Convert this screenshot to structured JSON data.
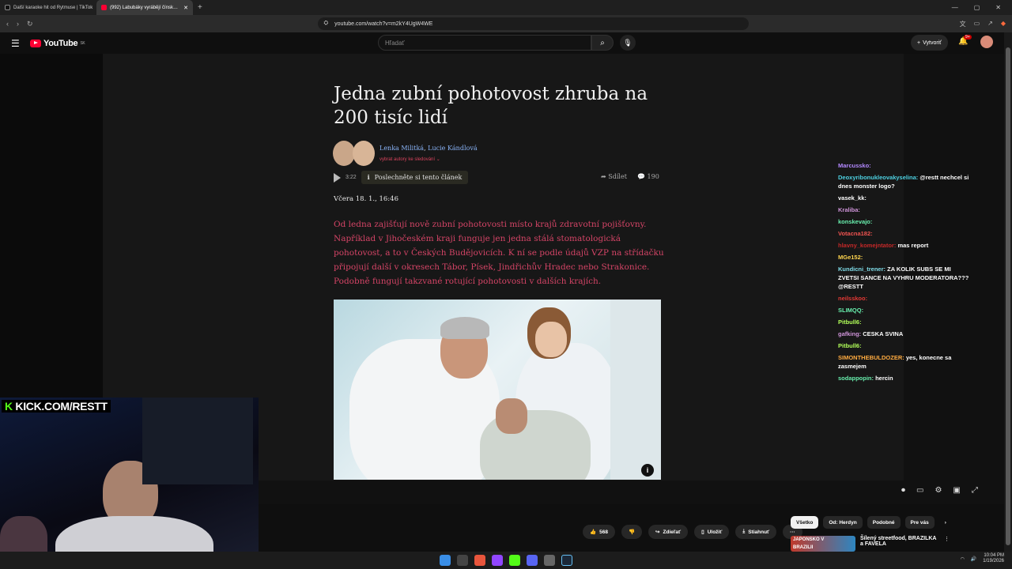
{
  "browser": {
    "tabs": [
      {
        "title": "Další karaoke hit od Rytmuse | TikTok",
        "active": false
      },
      {
        "title": "(992) Labubáky vyrábějí čínsk…",
        "active": true
      }
    ],
    "url": "youtube.com/watch?v=m2kY4UgW4WE"
  },
  "youtube": {
    "logo_text": "YouTube",
    "logo_region": "SK",
    "search_placeholder": "Hľadať",
    "create_label": "Vytvoriť",
    "notif_count": "9+"
  },
  "article": {
    "title": "Jedna zubní pohotovost zhruba na 200 tisíc lidí",
    "author1": "Lenka Militká",
    "author_sep": ",",
    "author2": "Lucie Kándlová",
    "follow_label": "vybrat autory ke sledování",
    "listen_time": "3:22",
    "listen_label": "Poslechněte si tento článek",
    "share_label": "Sdílet",
    "comment_count": "190",
    "date": "Včera 18. 1., 16:46",
    "lead": "Od ledna zajišťují nově zubní pohotovosti místo krajů zdravotní pojišťovny. Například v Jihočeském kraji funguje jen jedna stálá stomatologická pohotovost, a to v Českých Budějovicích. K ní se podle údajů VZP na střídačku připojují další v okresech Tábor, Písek, Jindřichův Hradec nebo Strakonice. Podobně fungují takzvané rotující pohotovosti v dalších krajích."
  },
  "overlay": {
    "kick_k": "K",
    "kick_url": "KICK.COM/RESTT"
  },
  "chat": [
    {
      "user": "Marcussko:",
      "color": "#b388ff",
      "text": ""
    },
    {
      "user": "Deoxyribonukleovakyselina:",
      "color": "#4dd0e1",
      "text": "@restt nechcel si dnes monster logo?"
    },
    {
      "user": "vasek_kk:",
      "color": "#ffffff",
      "text": ""
    },
    {
      "user": "Kraliba:",
      "color": "#ce93d8",
      "text": ""
    },
    {
      "user": "konskevajo:",
      "color": "#69f0ae",
      "text": ""
    },
    {
      "user": "Votacna182:",
      "color": "#ef5350",
      "text": ""
    },
    {
      "user": "hlavny_komejntator:",
      "color": "#c62828",
      "text": "mas report"
    },
    {
      "user": "MGe152:",
      "color": "#ffd54f",
      "text": ""
    },
    {
      "user": "Kundicni_trener:",
      "color": "#80deea",
      "text": "ZA KOLIK SUBS SE MI ZVETSI SANCE NA VYHRU MODERATORA??? @RESTT"
    },
    {
      "user": "neilsskoo:",
      "color": "#e53935",
      "text": ""
    },
    {
      "user": "SLIMQQ:",
      "color": "#69f0ae",
      "text": ""
    },
    {
      "user": "Pitbull6:",
      "color": "#b2ff59",
      "text": ""
    },
    {
      "user": "gafking:",
      "color": "#ce93d8",
      "text": "CESKA SVINA"
    },
    {
      "user": "Pitbull6:",
      "color": "#b2ff59",
      "text": ""
    },
    {
      "user": "SIMONTHEBULDOZER:",
      "color": "#ffab40",
      "text": "yes, konecne sa zasmejem"
    },
    {
      "user": "sodappopin:",
      "color": "#69f0ae",
      "text": "hercin"
    }
  ],
  "actions": {
    "likes": "568",
    "share": "Zdieľať",
    "save": "Uložiť",
    "download": "Stiahnuť",
    "more": "···"
  },
  "chips": [
    "Všetko",
    "Od: Herdyn",
    "Podobné",
    "Pre vás"
  ],
  "recommendation": {
    "title": "Šílený streetfood, BRAZILKA a FAVELA",
    "thumb_text": "JAPONSKO V BRAZILII"
  },
  "taskbar": {
    "time": "10:04 PM",
    "date": "1/19/2026"
  }
}
